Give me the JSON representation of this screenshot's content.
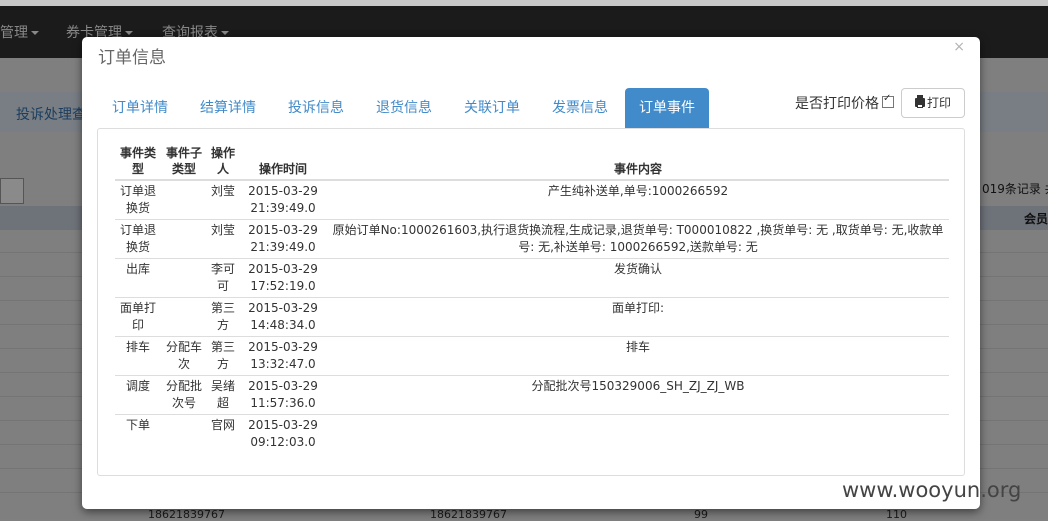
{
  "background": {
    "nav_items": [
      "管理",
      "券卡管理",
      "查询报表"
    ],
    "breadcrumb": "投诉处理查",
    "records_text": "019条记录 共",
    "member_col": "会员",
    "phone_values": [
      "18621839767",
      "18621839767",
      "99",
      "110"
    ]
  },
  "modal": {
    "title": "订单信息",
    "close": "×",
    "tabs": [
      "订单详情",
      "结算详情",
      "投诉信息",
      "退货信息",
      "关联订单",
      "发票信息",
      "订单事件"
    ],
    "active_tab": "订单事件",
    "print_price_label": "是否打印价格",
    "print_price_checked": true,
    "print_button": "打印"
  },
  "events_table": {
    "headers": {
      "type": "事件类型",
      "subtype": "事件子类型",
      "operator": "操作人",
      "time": "操作时间",
      "content": "事件内容"
    },
    "rows": [
      {
        "type": "订单退换货",
        "subtype": "",
        "operator": "刘莹",
        "date": "2015-03-29",
        "clock": "21:39:49.0",
        "content": "产生纯补送单,单号:1000266592"
      },
      {
        "type": "订单退换货",
        "subtype": "",
        "operator": "刘莹",
        "date": "2015-03-29",
        "clock": "21:39:49.0",
        "content": "原始订单No:1000261603,执行退货换流程,生成记录,退货单号: T000010822 ,换货单号: 无 ,取货单号: 无,收款单号: 无,补送单号: 1000266592,送款单号: 无"
      },
      {
        "type": "出库",
        "subtype": "",
        "operator": "李可可",
        "date": "2015-03-29",
        "clock": "17:52:19.0",
        "content": "发货确认"
      },
      {
        "type": "面单打印",
        "subtype": "",
        "operator": "第三方",
        "date": "2015-03-29",
        "clock": "14:48:34.0",
        "content": "面单打印:"
      },
      {
        "type": "排车",
        "subtype": "分配车次",
        "operator": "第三方",
        "date": "2015-03-29",
        "clock": "13:32:47.0",
        "content": "排车"
      },
      {
        "type": "调度",
        "subtype": "分配批次号",
        "operator": "吴绪超",
        "date": "2015-03-29",
        "clock": "11:57:36.0",
        "content": "分配批次号150329006_SH_ZJ_ZJ_WB"
      },
      {
        "type": "下单",
        "subtype": "",
        "operator": "官网",
        "date": "2015-03-29",
        "clock": "09:12:03.0",
        "content": ""
      }
    ]
  },
  "watermark": "www.wooyun.org"
}
